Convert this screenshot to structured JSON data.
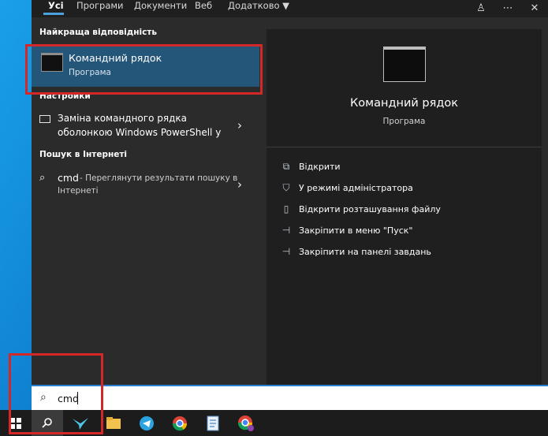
{
  "tabs": [
    {
      "label": "Усі",
      "active": true
    },
    {
      "label": "Програми"
    },
    {
      "label": "Документи"
    },
    {
      "label": "Веб"
    },
    {
      "label": "Додатково ▼"
    }
  ],
  "left": {
    "best_match_title": "Найкраща відповідність",
    "best_item_title": "Командний рядок",
    "best_item_sub": "Програма",
    "settings_title": "Настройки",
    "settings_item_line1": "Заміна командного рядка",
    "settings_item_line2": "оболонкою Windows PowerShell у",
    "web_title": "Пошук в Інтернеті",
    "web_query": "cmd",
    "web_suffix_line1": " - Переглянути результати пошуку в",
    "web_suffix_line2": "Інтернеті"
  },
  "right": {
    "title": "Командний рядок",
    "sub": "Програма",
    "actions": [
      {
        "label": "Відкрити",
        "icon": "open-icon"
      },
      {
        "label": "У режимі адміністратора",
        "icon": "shield-icon"
      },
      {
        "label": "Відкрити розташування файлу",
        "icon": "folder-icon"
      },
      {
        "label": "Закріпити в меню \"Пуск\"",
        "icon": "pin-icon"
      },
      {
        "label": "Закріпити на панелі завдань",
        "icon": "pin-icon"
      }
    ]
  },
  "search": {
    "value": "cmd"
  },
  "taskbar": {
    "icons": [
      "windows-start-icon",
      "search-icon",
      "bird-app-icon",
      "file-explorer-icon",
      "telegram-icon",
      "chrome-icon",
      "notepad-icon",
      "chrome-profile-icon"
    ]
  },
  "colors": {
    "accent": "#2b7fd1",
    "selection": "#245679",
    "highlight": "#d42727"
  }
}
